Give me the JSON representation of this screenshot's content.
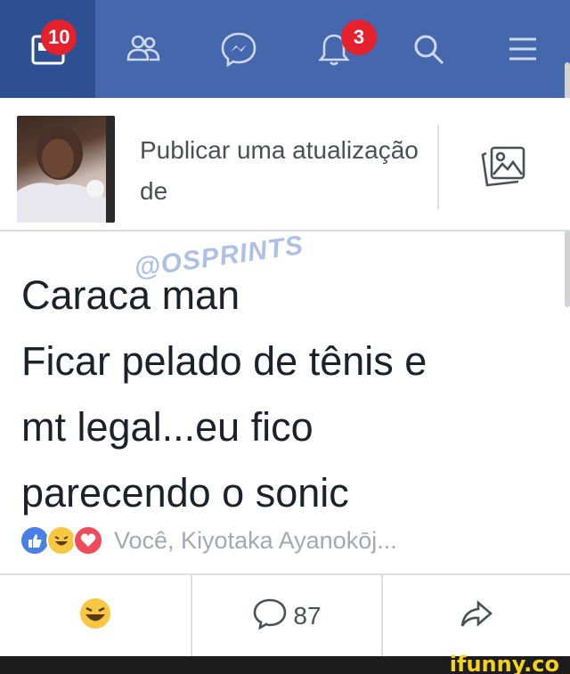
{
  "nav": {
    "items": [
      {
        "icon": "news-feed-icon",
        "badge": "10",
        "active": true
      },
      {
        "icon": "friends-icon",
        "badge": null
      },
      {
        "icon": "messenger-icon",
        "badge": null
      },
      {
        "icon": "notifications-icon",
        "badge": "3"
      },
      {
        "icon": "search-icon",
        "badge": null
      },
      {
        "icon": "menu-icon",
        "badge": null
      }
    ],
    "colors": {
      "bar": "#4467ad",
      "active": "#2f4f93",
      "badge": "#e4212d"
    }
  },
  "composer": {
    "placeholder": "Publicar uma atualização de",
    "photo_icon": "photo-icon"
  },
  "post": {
    "watermark": "@OSPRINTS",
    "lines": [
      "Caraca man",
      "Ficar pelado de tênis e",
      "mt legal...eu fico",
      "parecendo o sonic"
    ],
    "reactions": [
      "like-icon",
      "haha-icon",
      "love-icon"
    ],
    "reactors": "Você, Kiyotaka Ayanokōj..."
  },
  "actions": {
    "react_icon": "haha-icon",
    "comment_count": "87",
    "share_icon": "share-icon"
  },
  "footer": {
    "brand": "ifunny.co"
  }
}
